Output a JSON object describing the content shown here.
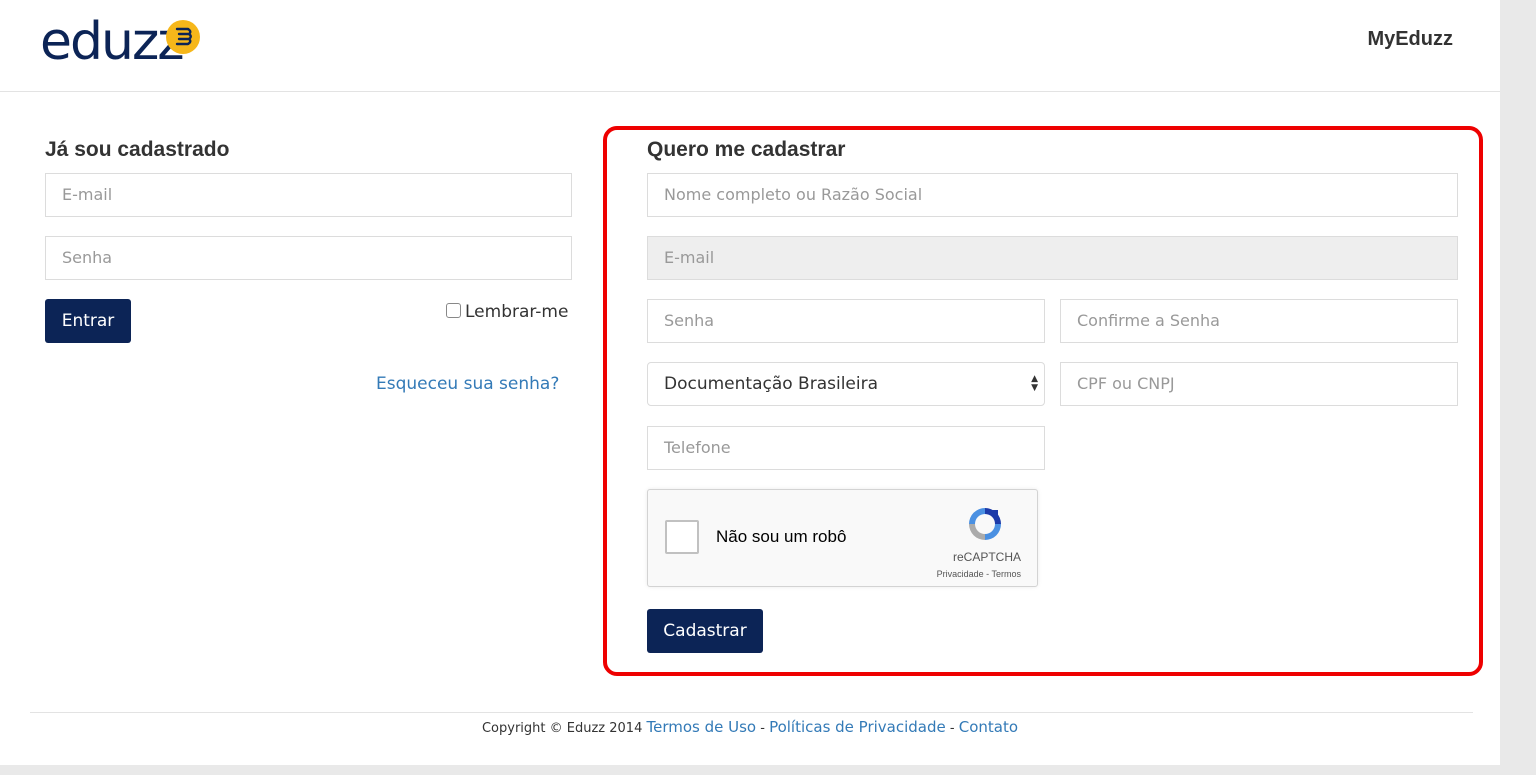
{
  "header": {
    "logo_text": "eduzz",
    "nav_link": "MyEduzz"
  },
  "login": {
    "title": "Já sou cadastrado",
    "email_placeholder": "E-mail",
    "password_placeholder": "Senha",
    "submit_label": "Entrar",
    "remember_label": "Lembrar-me",
    "forgot_link": "Esqueceu sua senha?"
  },
  "register": {
    "title": "Quero me cadastrar",
    "name_placeholder": "Nome completo ou Razão Social",
    "email_placeholder": "E-mail",
    "password_placeholder": "Senha",
    "confirm_password_placeholder": "Confirme a Senha",
    "document_type_selected": "Documentação Brasileira",
    "document_placeholder": "CPF ou CNPJ",
    "phone_placeholder": "Telefone",
    "submit_label": "Cadastrar"
  },
  "recaptcha": {
    "label": "Não sou um robô",
    "brand": "reCAPTCHA",
    "privacy_link": "Privacidade",
    "separator": " - ",
    "terms_link": "Termos"
  },
  "footer": {
    "copyright": "Copyright © Eduzz 2014",
    "terms_link": "Termos de Uso",
    "privacy_link": "Políticas de Privacidade",
    "contact_link": "Contato",
    "separator": " - "
  },
  "colors": {
    "brand_navy": "#0c2456",
    "logo_badge": "#f6b71a",
    "link_blue": "#337ab7",
    "highlight_red": "#ee0000"
  }
}
